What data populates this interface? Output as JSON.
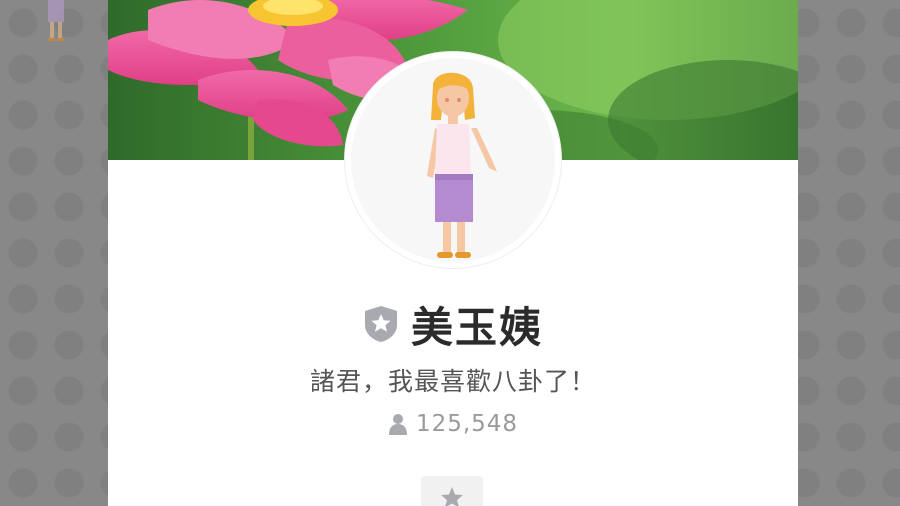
{
  "profile": {
    "name": "美玉姨",
    "status_message": "諸君，我最喜歡八卦了！",
    "follower_count": "125,548"
  },
  "icons": {
    "badge": "official-star-shield-icon",
    "followers": "person-icon",
    "favorite": "star-icon"
  },
  "colors": {
    "name_text": "#2b2b2b",
    "status_text": "#555555",
    "count_text": "#9a9a9a",
    "badge_gray": "#a9a9b0"
  }
}
